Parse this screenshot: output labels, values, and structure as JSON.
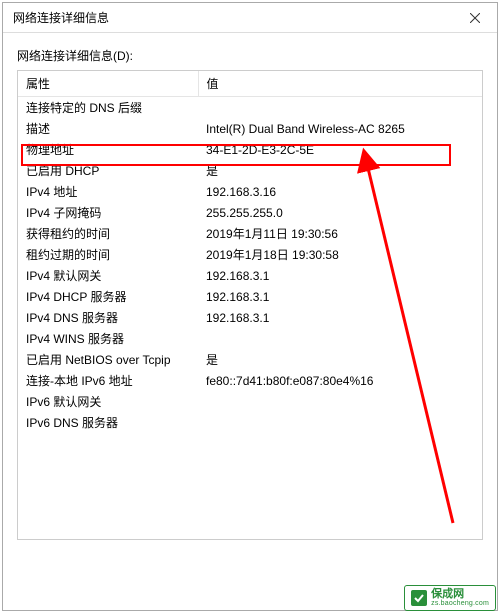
{
  "window": {
    "title": "网络连接详细信息",
    "close_icon": "×"
  },
  "list_label": "网络连接详细信息(D):",
  "headers": {
    "property": "属性",
    "value": "值"
  },
  "rows": [
    {
      "prop": "连接特定的 DNS 后缀",
      "val": ""
    },
    {
      "prop": "描述",
      "val": "Intel(R) Dual Band Wireless-AC 8265"
    },
    {
      "prop": "物理地址",
      "val": "34-E1-2D-E3-2C-5E"
    },
    {
      "prop": "已启用 DHCP",
      "val": "是"
    },
    {
      "prop": "IPv4 地址",
      "val": "192.168.3.16"
    },
    {
      "prop": "IPv4 子网掩码",
      "val": "255.255.255.0"
    },
    {
      "prop": "获得租约的时间",
      "val": "2019年1月11日 19:30:56"
    },
    {
      "prop": "租约过期的时间",
      "val": "2019年1月18日 19:30:58"
    },
    {
      "prop": "IPv4 默认网关",
      "val": "192.168.3.1"
    },
    {
      "prop": "IPv4 DHCP 服务器",
      "val": "192.168.3.1"
    },
    {
      "prop": "IPv4 DNS 服务器",
      "val": "192.168.3.1"
    },
    {
      "prop": "IPv4 WINS 服务器",
      "val": ""
    },
    {
      "prop": "已启用 NetBIOS over Tcpip",
      "val": "是"
    },
    {
      "prop": "连接-本地 IPv6 地址",
      "val": "fe80::7d41:b80f:e087:80e4%16"
    },
    {
      "prop": "IPv6 默认网关",
      "val": ""
    },
    {
      "prop": "IPv6 DNS 服务器",
      "val": ""
    }
  ],
  "watermark": {
    "cn": "保成网",
    "en": "zs.baocheng.com"
  }
}
